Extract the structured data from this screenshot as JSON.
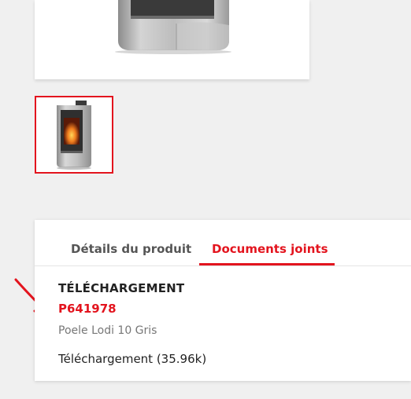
{
  "tabs": {
    "details_label": "Détails du produit",
    "documents_label": "Documents joints",
    "active": "documents"
  },
  "documents": {
    "section_title": "TÉLÉCHARGEMENT",
    "items": [
      {
        "reference": "P641978",
        "name": "Poele Lodi 10 Gris",
        "download_label": "Téléchargement (35.96k)"
      }
    ]
  },
  "colors": {
    "accent": "#e3141e",
    "text": "#222222",
    "muted": "#777777",
    "background": "#f0f0f0"
  },
  "icons": {
    "annotation": "red-arrow-icon"
  }
}
